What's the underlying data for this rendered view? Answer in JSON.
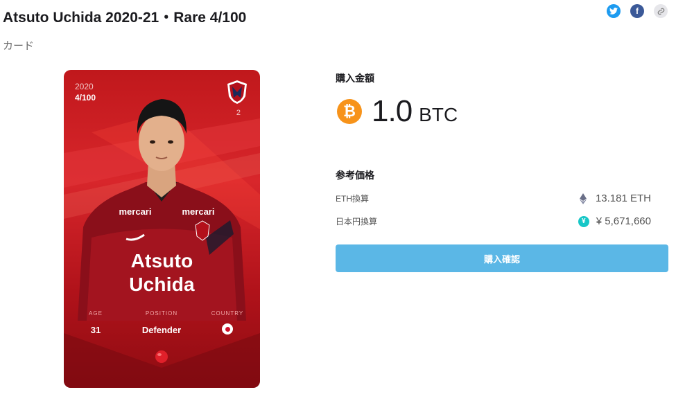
{
  "page": {
    "title": "Atsuto Uchida 2020-21・Rare 4/100",
    "category": "カード"
  },
  "share": {
    "icons": [
      "twitter-icon",
      "facebook-icon",
      "link-icon"
    ],
    "facebook_glyph": "f"
  },
  "card": {
    "year": "2020",
    "serial": "4/100",
    "jersey_number": "2",
    "name_line1": "Atsuto",
    "name_line2": "Uchida",
    "sponsor": "mercari",
    "stats": [
      {
        "label": "AGE",
        "value": "31"
      },
      {
        "label": "POSITION",
        "value": "Defender"
      },
      {
        "label": "COUNTRY",
        "value": ""
      }
    ],
    "colors": {
      "primary": "#d8262b",
      "dark": "#8e0c12"
    }
  },
  "purchase": {
    "heading": "購入金額",
    "btc_glyph": "₿",
    "amount": "1.0",
    "currency": "BTC",
    "reference_heading": "参考価格",
    "references": [
      {
        "label": "ETH換算",
        "icon": "ethereum-icon",
        "value": "13.181 ETH"
      },
      {
        "label": "日本円換算",
        "icon": "yen-icon",
        "icon_glyph": "¥",
        "value": "¥ 5,671,660"
      }
    ],
    "confirm_label": "購入確認",
    "colors": {
      "btc": "#f7931a",
      "button": "#5bb7e6",
      "yen": "#17c7c7"
    }
  }
}
